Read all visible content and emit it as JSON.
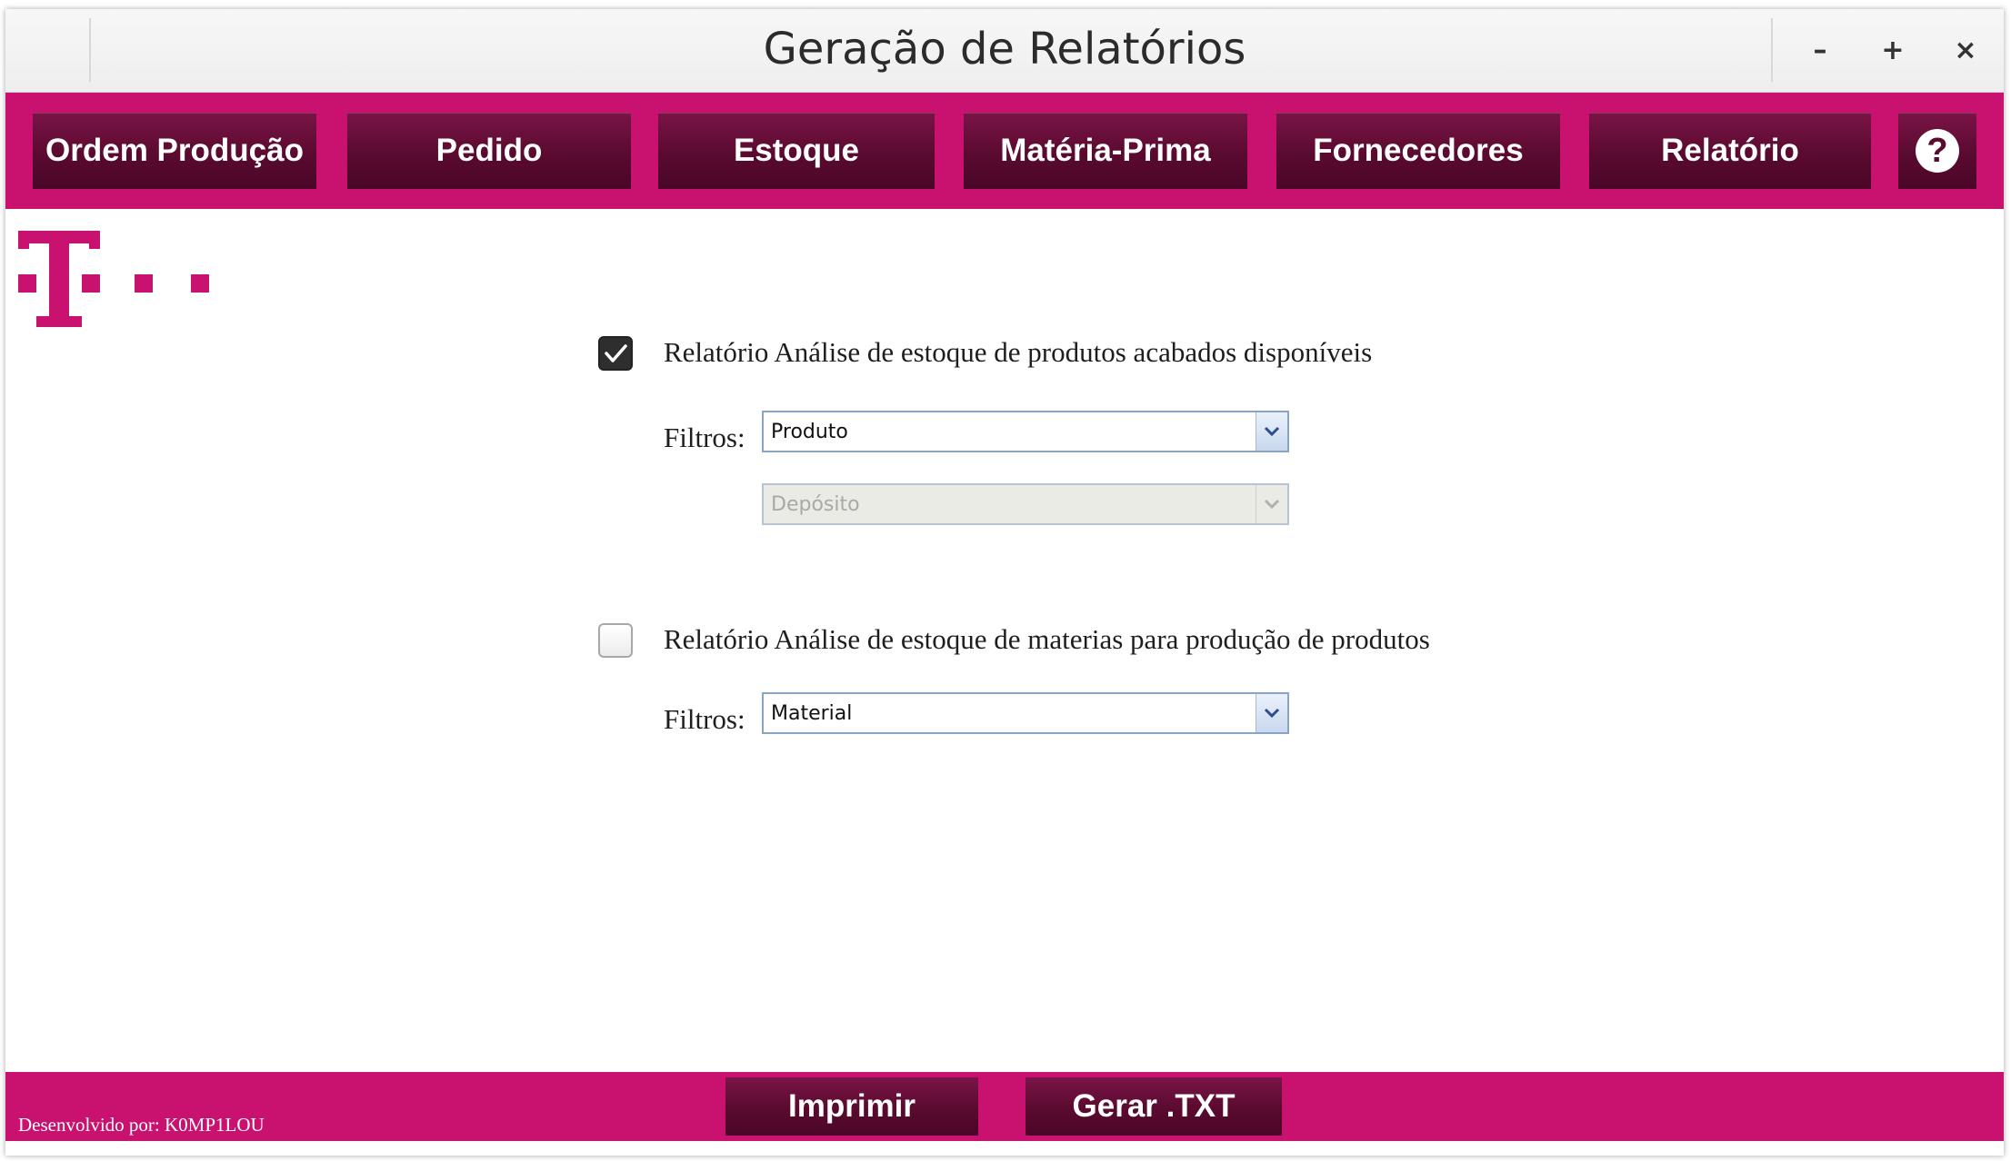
{
  "window": {
    "title": "Geração de Relatórios",
    "controls": {
      "minimize": "–",
      "maximize": "+",
      "close": "×"
    }
  },
  "nav": {
    "items": [
      {
        "label": "Ordem Produção"
      },
      {
        "label": "Pedido"
      },
      {
        "label": "Estoque"
      },
      {
        "label": "Matéria-Prima"
      },
      {
        "label": "Fornecedores"
      },
      {
        "label": "Relatório"
      }
    ],
    "help_label": "?"
  },
  "reports": [
    {
      "checked": true,
      "label": "Relatório Análise de estoque de produtos acabados disponíveis",
      "filters_label": "Filtros:",
      "filters": [
        {
          "value": "Produto",
          "enabled": true
        },
        {
          "value": "Depósito",
          "enabled": false
        }
      ]
    },
    {
      "checked": false,
      "label": "Relatório Análise de estoque de materias para produção de produtos",
      "filters_label": "Filtros:",
      "filters": [
        {
          "value": "Material",
          "enabled": true
        }
      ]
    }
  ],
  "footer": {
    "credit": "Desenvolvido por: K0MP1LOU",
    "print_label": "Imprimir",
    "txt_label": "Gerar .TXT"
  },
  "colors": {
    "brand": "#c9126f",
    "button_dark": "#5a0a2f"
  },
  "icons": {
    "logo": "t-logo-icon",
    "help": "help-icon",
    "check": "checkmark-icon",
    "dropdown": "chevron-down-icon"
  }
}
